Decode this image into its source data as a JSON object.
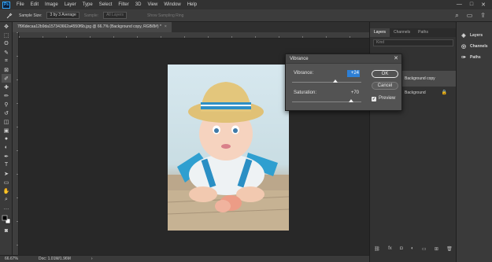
{
  "app": {
    "logo_text": "Ps"
  },
  "menu": [
    "File",
    "Edit",
    "Image",
    "Layer",
    "Type",
    "Select",
    "Filter",
    "3D",
    "View",
    "Window",
    "Help"
  ],
  "window_controls": [
    "—",
    "□",
    "✕"
  ],
  "options_bar": {
    "sample_size_label": "Sample Size:",
    "sample_size_value": "3 by 3 Average",
    "sample_label": "Sample:",
    "sample_value": "All Layers",
    "show_ring_label": "Show Sampling Ring"
  },
  "document": {
    "tab_title": "7f96decaa12b9da157343662a4550f6b.jpg @ 66.7% (Background copy, RGB/8#) *",
    "zoom": "66.67%",
    "doc_info": "Doc: 1.01M/1.96M"
  },
  "layers_panel": {
    "tabs": [
      "Layers",
      "Channels",
      "Paths"
    ],
    "search_placeholder": "Kind",
    "layers": [
      {
        "name": "Background copy"
      },
      {
        "name": "Background"
      }
    ]
  },
  "icon_strip": [
    {
      "label": "Layers",
      "icon": "layers-icon"
    },
    {
      "label": "Channels",
      "icon": "channels-icon"
    },
    {
      "label": "Paths",
      "icon": "paths-icon"
    }
  ],
  "vibrance_dialog": {
    "title": "Vibrance",
    "vibrance_label": "Vibrance:",
    "vibrance_value": "+24",
    "vibrance_level": 24,
    "saturation_label": "Saturation:",
    "saturation_value": "+70",
    "saturation_level": 70,
    "ok_label": "OK",
    "cancel_label": "Cancel",
    "preview_label": "Preview",
    "preview_checked": true
  },
  "colors": {
    "accent": "#2d7fd6",
    "ps_blue": "#31a8ff"
  }
}
